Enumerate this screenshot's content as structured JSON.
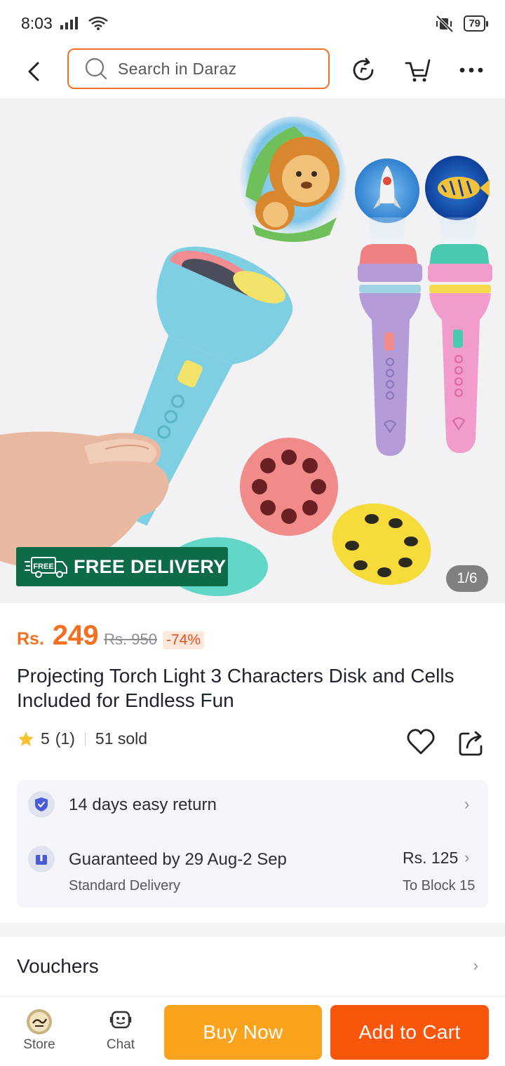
{
  "status": {
    "time": "8:03",
    "battery": "79"
  },
  "search": {
    "placeholder": "Search in Daraz"
  },
  "hero": {
    "badge": "FREE DELIVERY",
    "badge_icon_text": "FREE",
    "counter": "1/6"
  },
  "product": {
    "currency": "Rs.",
    "price": "249",
    "old_price": "Rs. 950",
    "discount": "-74%",
    "title": "Projecting Torch Light 3 Characters Disk and Cells Included for Endless Fun",
    "rating": "5",
    "reviews": "(1)",
    "sold": "51 sold"
  },
  "delivery": {
    "return_text": "14 days easy return",
    "guarantee_text": "Guaranteed by 29 Aug-2 Sep",
    "delivery_type": "Standard Delivery",
    "fee": "Rs. 125",
    "location": "To Block 15"
  },
  "vouchers": {
    "title": "Vouchers"
  },
  "bottom": {
    "store": "Store",
    "chat": "Chat",
    "buy_now": "Buy Now",
    "add_to_cart": "Add to Cart"
  },
  "colors": {
    "accent": "#f36f21",
    "buy": "#fca31e",
    "cart": "#f9560c",
    "badge": "#0e6b47"
  }
}
